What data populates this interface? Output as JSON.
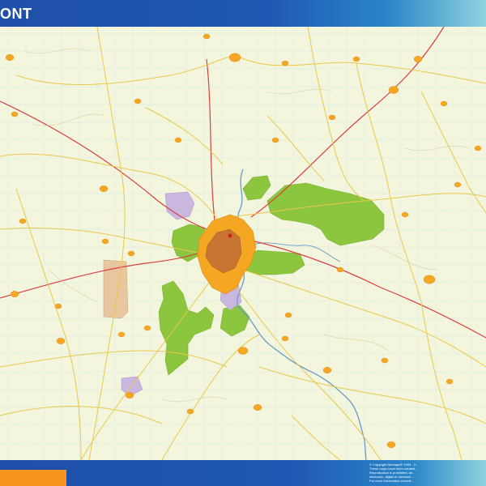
{
  "header": {
    "title": "ONT"
  },
  "colors": {
    "header_blue": "#1f58b4",
    "map_background": "#f3f5dd",
    "grid": "#cfe8e4",
    "forest": "#8cc63f",
    "town": "#f5a623",
    "industrial": "#c9b7e0",
    "city_center": "#c87533",
    "motorway": "#d84040",
    "main_road": "#e9c94a",
    "river": "#6a9ac9",
    "footer_tab": "#f7941d"
  },
  "footer": {
    "copyright_lines": [
      "© Copyright Netmaps® 1993 - 2...",
      "These maps have been created...",
      "Reproduction is prohibited, an...",
      "electronic, digital or mechani...",
      "For more information consult:..."
    ]
  }
}
